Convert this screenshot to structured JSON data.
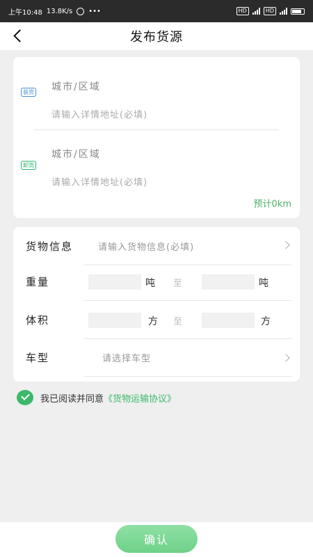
{
  "statusbar": {
    "time": "上午10:48",
    "speed": "13.8K/s",
    "hd1": "HD",
    "hd2": "HD"
  },
  "nav": {
    "title": "发布货源"
  },
  "address": {
    "load_tag": "装货",
    "unload_tag": "卸货",
    "load_city": "城市/区域",
    "load_detail": "请输入详情地址(必填)",
    "unload_city": "城市/区域",
    "unload_detail": "请输入详情地址(必填)",
    "estimate": "预计0km"
  },
  "goods": {
    "info_label": "货物信息",
    "info_placeholder": "请输入货物信息(必填)",
    "weight_label": "重量",
    "weight_unit": "吨",
    "weight_to": "至",
    "weight_unit2": "吨",
    "volume_label": "体积",
    "volume_unit": "方",
    "volume_to": "至",
    "volume_unit2": "方",
    "truck_label": "车型",
    "truck_placeholder": "请选择车型"
  },
  "agreement": {
    "checked": true,
    "text": "我已阅读并同意",
    "link": "《货物运输协议》"
  },
  "footer": {
    "confirm_label": "确认"
  },
  "colors": {
    "accent": "#3cb86a",
    "button": "#7cd794",
    "background": "#efefef"
  }
}
